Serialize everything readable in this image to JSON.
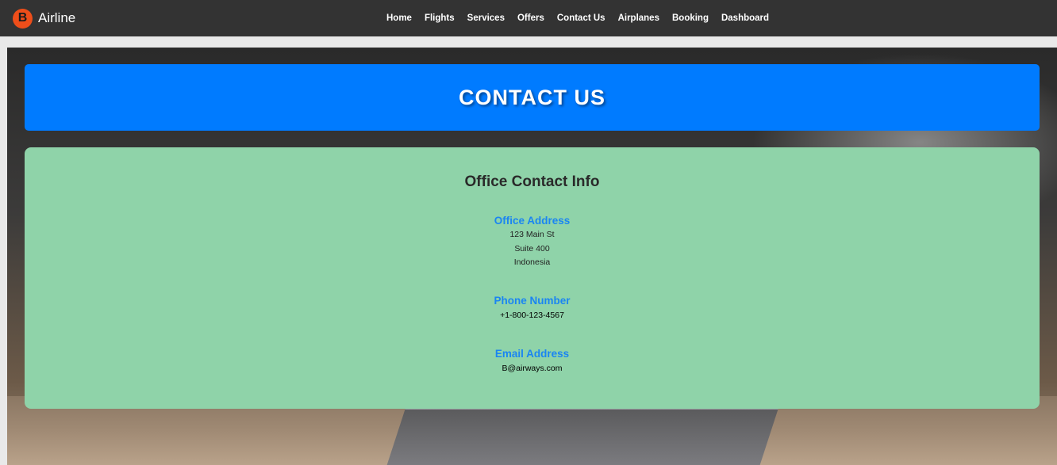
{
  "app": {
    "logo_letter": "B",
    "brand_name": "Airline"
  },
  "nav": {
    "items": [
      {
        "label": "Home"
      },
      {
        "label": "Flights"
      },
      {
        "label": "Services"
      },
      {
        "label": "Offers"
      },
      {
        "label": "Contact Us"
      },
      {
        "label": "Airplanes"
      },
      {
        "label": "Booking"
      },
      {
        "label": "Dashboard"
      }
    ]
  },
  "banner": {
    "title": "CONTACT US"
  },
  "contact": {
    "heading": "Office Contact Info",
    "address": {
      "label": "Office Address",
      "lines": [
        "123 Main St",
        "Suite 400",
        "Indonesia"
      ]
    },
    "phone": {
      "label": "Phone Number",
      "value": "+1-800-123-4567"
    },
    "email": {
      "label": "Email Address",
      "value": "B@airways.com"
    }
  },
  "colors": {
    "navbar_bg": "#333333",
    "logo_bg": "#ee4e1a",
    "banner_bg": "#007bff",
    "card_bg": "#8fd3a9",
    "section_label": "#1a85f2"
  }
}
